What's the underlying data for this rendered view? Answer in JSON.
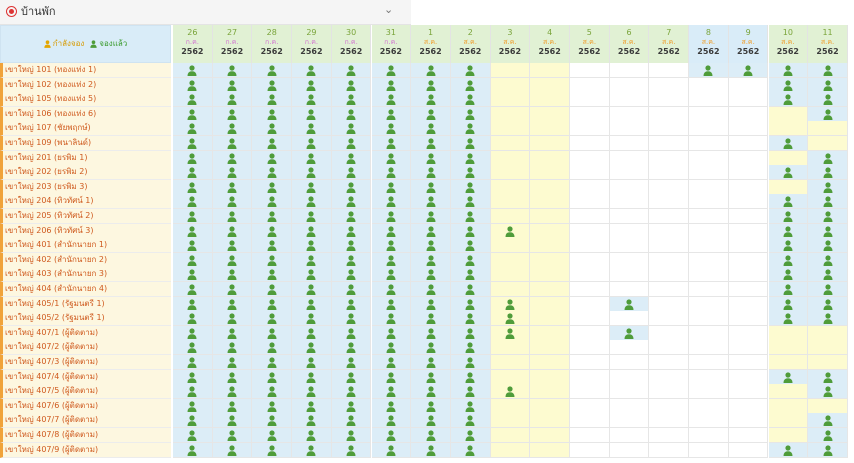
{
  "panel": {
    "title": "บ้านพัก",
    "chevron": "⌄"
  },
  "legend": {
    "pending": "กำลังจอง",
    "booked": "จองแล้ว"
  },
  "colors": {
    "blue_cell": "#dcedf7",
    "yellow_cell": "#fdfbd0",
    "white_cell": "#ffffff",
    "blue_head": "#d9ecf8",
    "green_head": "#e1f1d4",
    "booked": "#4f9c3a",
    "month_jul": "#d27bd0",
    "month_aug": "#ef9f2f"
  },
  "dates": [
    {
      "day": "26",
      "month": "ก.ค.",
      "year": "2562",
      "bg": "green",
      "mcolor": "jul",
      "col": "blue"
    },
    {
      "day": "27",
      "month": "ก.ค.",
      "year": "2562",
      "bg": "green",
      "mcolor": "jul",
      "col": "blue"
    },
    {
      "day": "28",
      "month": "ก.ค.",
      "year": "2562",
      "bg": "green",
      "mcolor": "jul",
      "col": "blue"
    },
    {
      "day": "29",
      "month": "ก.ค.",
      "year": "2562",
      "bg": "green",
      "mcolor": "jul",
      "col": "blue"
    },
    {
      "day": "30",
      "month": "ก.ค.",
      "year": "2562",
      "bg": "green",
      "mcolor": "jul",
      "col": "blue"
    },
    {
      "day": "31",
      "month": "ก.ค.",
      "year": "2562",
      "bg": "green",
      "mcolor": "jul",
      "col": "blue"
    },
    {
      "day": "1",
      "month": "ส.ค.",
      "year": "2562",
      "bg": "green",
      "mcolor": "aug",
      "col": "blue"
    },
    {
      "day": "2",
      "month": "ส.ค.",
      "year": "2562",
      "bg": "green",
      "mcolor": "aug",
      "col": "blue"
    },
    {
      "day": "3",
      "month": "ส.ค.",
      "year": "2562",
      "bg": "green",
      "mcolor": "aug",
      "col": "yellow"
    },
    {
      "day": "4",
      "month": "ส.ค.",
      "year": "2562",
      "bg": "green",
      "mcolor": "aug",
      "col": "yellow"
    },
    {
      "day": "5",
      "month": "ส.ค.",
      "year": "2562",
      "bg": "green",
      "mcolor": "aug",
      "col": "white"
    },
    {
      "day": "6",
      "month": "ส.ค.",
      "year": "2562",
      "bg": "green",
      "mcolor": "aug",
      "col": "white"
    },
    {
      "day": "7",
      "month": "ส.ค.",
      "year": "2562",
      "bg": "green",
      "mcolor": "aug",
      "col": "white"
    },
    {
      "day": "8",
      "month": "ส.ค.",
      "year": "2562",
      "bg": "blue",
      "mcolor": "aug",
      "col": "white"
    },
    {
      "day": "9",
      "month": "ส.ค.",
      "year": "2562",
      "bg": "blue",
      "mcolor": "aug",
      "col": "white"
    },
    {
      "day": "10",
      "month": "ส.ค.",
      "year": "2562",
      "bg": "green",
      "mcolor": "aug",
      "col": "white"
    },
    {
      "day": "11",
      "month": "ส.ค.",
      "year": "2562",
      "bg": "green",
      "mcolor": "aug",
      "col": "white"
    }
  ],
  "rooms": [
    {
      "name": "เขาใหญ่ 101 (ทองแท่ง 1)",
      "booked": [
        0,
        1,
        2,
        3,
        4,
        5,
        6,
        7,
        13,
        14,
        15,
        16
      ]
    },
    {
      "name": "เขาใหญ่ 102 (ทองแท่ง 2)",
      "booked": [
        0,
        1,
        2,
        3,
        4,
        5,
        6,
        7,
        15,
        16
      ]
    },
    {
      "name": "เขาใหญ่ 105 (ทองแท่ง 5)",
      "booked": [
        0,
        1,
        2,
        3,
        4,
        5,
        6,
        7,
        15,
        16
      ]
    },
    {
      "name": "เขาใหญ่ 106 (ทองแท่ง 6)",
      "booked": [
        0,
        1,
        2,
        3,
        4,
        5,
        6,
        7,
        16
      ]
    },
    {
      "name": "เขาใหญ่ 107 (ชัยพฤกษ์)",
      "booked": [
        0,
        1,
        2,
        3,
        4,
        5,
        6,
        7
      ]
    },
    {
      "name": "เขาใหญ่ 109 (พนาลินด์)",
      "booked": [
        0,
        1,
        2,
        3,
        4,
        5,
        6,
        7,
        15
      ]
    },
    {
      "name": "เขาใหญ่ 201 (ยรพิม 1)",
      "booked": [
        0,
        1,
        2,
        3,
        4,
        5,
        6,
        7,
        16
      ]
    },
    {
      "name": "เขาใหญ่ 202 (ยรพิม 2)",
      "booked": [
        0,
        1,
        2,
        3,
        4,
        5,
        6,
        7,
        15,
        16
      ]
    },
    {
      "name": "เขาใหญ่ 203 (ยรพิม 3)",
      "booked": [
        0,
        1,
        2,
        3,
        4,
        5,
        6,
        7,
        16
      ]
    },
    {
      "name": "เขาใหญ่ 204 (ทิวทัศน์ 1)",
      "booked": [
        0,
        1,
        2,
        3,
        4,
        5,
        6,
        7,
        15,
        16
      ]
    },
    {
      "name": "เขาใหญ่ 205 (ทิวทัศน์ 2)",
      "booked": [
        0,
        1,
        2,
        3,
        4,
        5,
        6,
        7,
        15,
        16
      ]
    },
    {
      "name": "เขาใหญ่ 206 (ทิวทัศน์ 3)",
      "booked": [
        0,
        1,
        2,
        3,
        4,
        5,
        6,
        7,
        8,
        15,
        16
      ]
    },
    {
      "name": "เขาใหญ่ 401 (สำนักนายก 1)",
      "booked": [
        0,
        1,
        2,
        3,
        4,
        5,
        6,
        7,
        15,
        16
      ]
    },
    {
      "name": "เขาใหญ่ 402 (สำนักนายก 2)",
      "booked": [
        0,
        1,
        2,
        3,
        4,
        5,
        6,
        7,
        15,
        16
      ]
    },
    {
      "name": "เขาใหญ่ 403 (สำนักนายก 3)",
      "booked": [
        0,
        1,
        2,
        3,
        4,
        5,
        6,
        7,
        15,
        16
      ]
    },
    {
      "name": "เขาใหญ่ 404 (สำนักนายก 4)",
      "booked": [
        0,
        1,
        2,
        3,
        4,
        5,
        6,
        7,
        15,
        16
      ]
    },
    {
      "name": "เขาใหญ่ 405/1 (รัฐมนตรี 1)",
      "booked": [
        0,
        1,
        2,
        3,
        4,
        5,
        6,
        7,
        8,
        11,
        15,
        16
      ]
    },
    {
      "name": "เขาใหญ่ 405/2 (รัฐมนตรี 1)",
      "booked": [
        0,
        1,
        2,
        3,
        4,
        5,
        6,
        7,
        8,
        15,
        16
      ]
    },
    {
      "name": "เขาใหญ่ 407/1 (ผู้ติดตาม)",
      "booked": [
        0,
        1,
        2,
        3,
        4,
        5,
        6,
        7,
        8,
        11
      ]
    },
    {
      "name": "เขาใหญ่ 407/2 (ผู้ติดตาม)",
      "booked": [
        0,
        1,
        2,
        3,
        4,
        5,
        6,
        7
      ]
    },
    {
      "name": "เขาใหญ่ 407/3 (ผู้ติดตาม)",
      "booked": [
        0,
        1,
        2,
        3,
        4,
        5,
        6,
        7
      ]
    },
    {
      "name": "เขาใหญ่ 407/4 (ผู้ติดตาม)",
      "booked": [
        0,
        1,
        2,
        3,
        4,
        5,
        6,
        7,
        15,
        16
      ]
    },
    {
      "name": "เขาใหญ่ 407/5 (ผู้ติดตาม)",
      "booked": [
        0,
        1,
        2,
        3,
        4,
        5,
        6,
        7,
        8,
        16
      ]
    },
    {
      "name": "เขาใหญ่ 407/6 (ผู้ติดตาม)",
      "booked": [
        0,
        1,
        2,
        3,
        4,
        5,
        6,
        7
      ]
    },
    {
      "name": "เขาใหญ่ 407/7 (ผู้ติดตาม)",
      "booked": [
        0,
        1,
        2,
        3,
        4,
        5,
        6,
        7,
        16
      ]
    },
    {
      "name": "เขาใหญ่ 407/8 (ผู้ติดตาม)",
      "booked": [
        0,
        1,
        2,
        3,
        4,
        5,
        6,
        7,
        16
      ]
    },
    {
      "name": "เขาใหญ่ 407/9 (ผู้ติดตาม)",
      "booked": [
        0,
        1,
        2,
        3,
        4,
        5,
        6,
        7,
        15,
        16
      ]
    }
  ]
}
